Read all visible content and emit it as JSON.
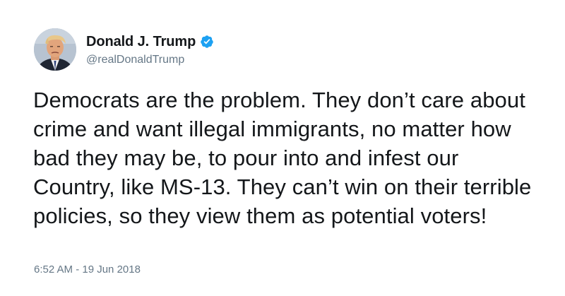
{
  "tweet": {
    "author": {
      "display_name": "Donald J. Trump",
      "handle": "@realDonaldTrump",
      "verified": true,
      "avatar_icon": "profile-photo",
      "verified_icon": "verified-badge-icon"
    },
    "text": "Democrats are the problem. They don’t care about crime and want illegal immigrants, no matter how bad they may be, to pour into and infest our Country, like MS-13. They can’t win on their terrible policies, so they view them as potential voters!",
    "timestamp": "6:52 AM - 19 Jun 2018"
  },
  "colors": {
    "text": "#14171a",
    "secondary": "#657786",
    "verified_blue": "#1da1f2",
    "background": "#ffffff"
  }
}
